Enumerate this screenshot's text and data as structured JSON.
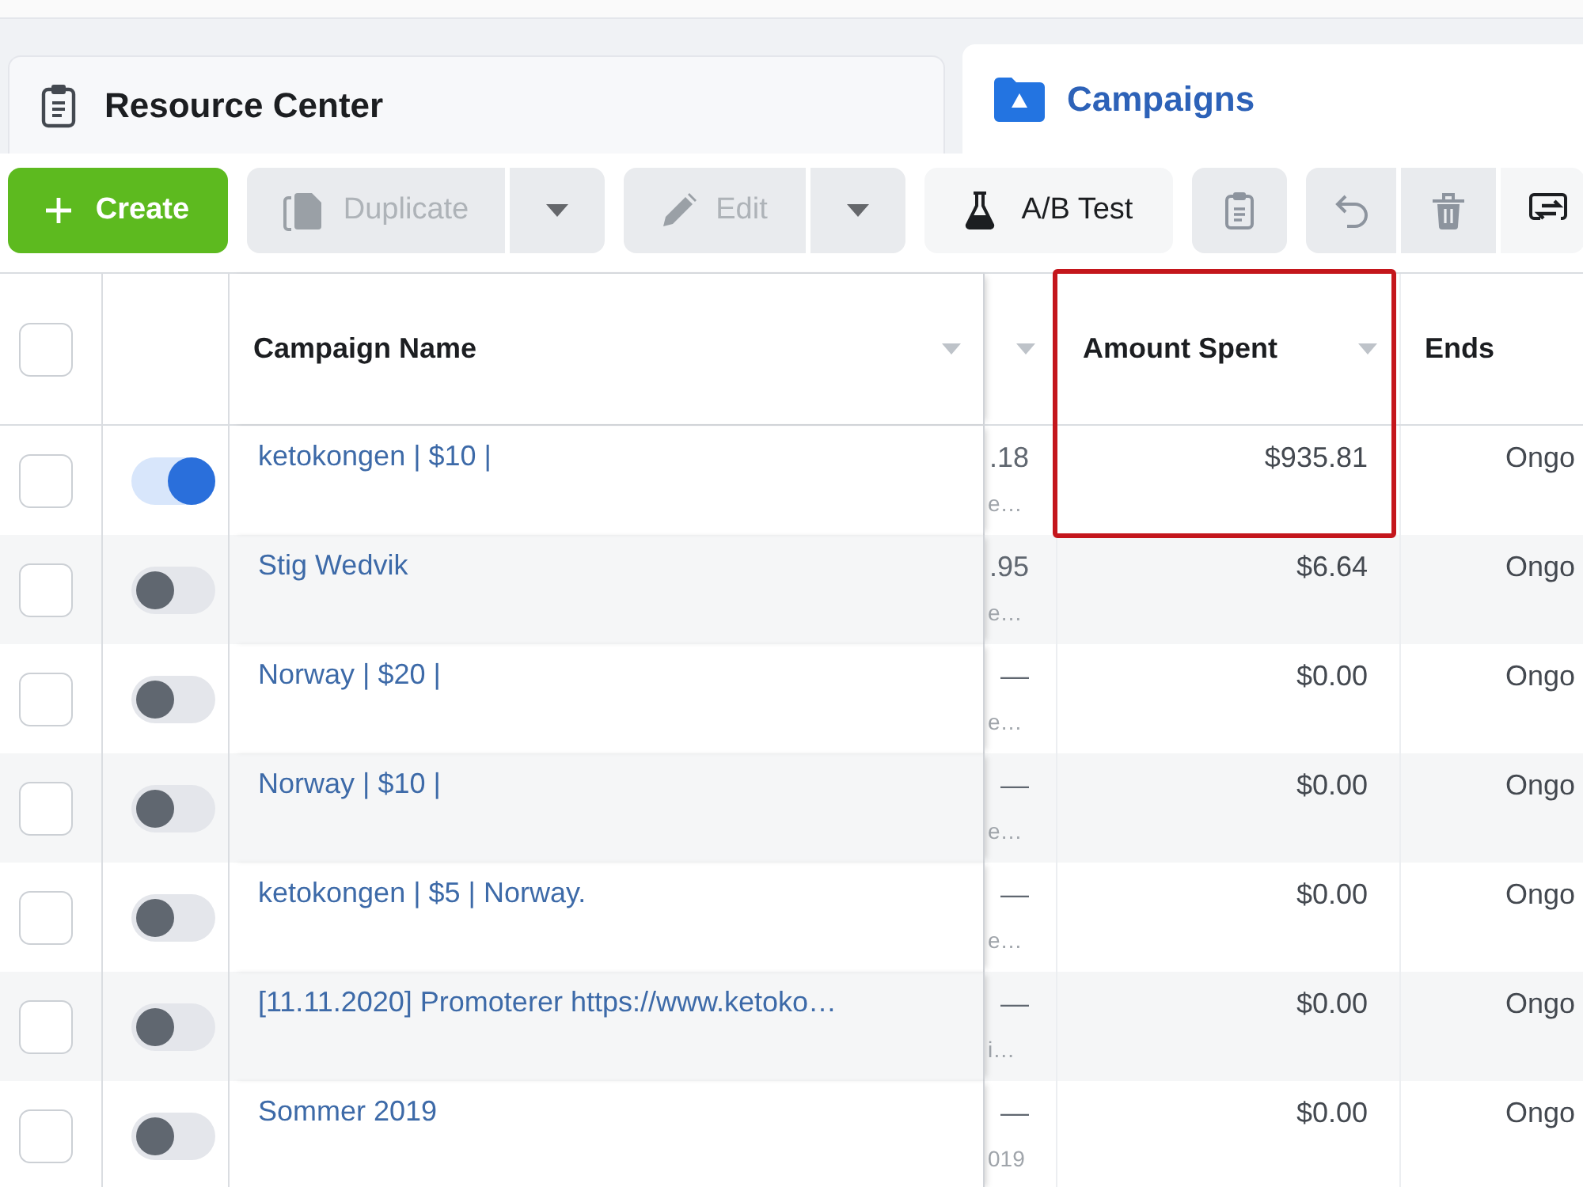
{
  "tabs": [
    {
      "label": "Resource Center",
      "kind": "resources",
      "selected": false
    },
    {
      "label": "Campaigns",
      "kind": "campaigns",
      "selected": true
    }
  ],
  "toolbar": [
    {
      "buttons": [
        {
          "kind": "create",
          "label": "Create",
          "disabled": false
        }
      ]
    },
    {
      "buttons": [
        {
          "kind": "duplicate",
          "label": "Duplicate",
          "disabled": true
        },
        {
          "kind": "menu",
          "disabled": true
        }
      ]
    },
    {
      "buttons": [
        {
          "kind": "edit",
          "label": "Edit",
          "disabled": true
        },
        {
          "kind": "menu",
          "disabled": true
        }
      ]
    },
    {
      "buttons": [
        {
          "kind": "ab-test",
          "label": "A/B Test",
          "disabled": false
        }
      ]
    },
    {
      "buttons": [
        {
          "kind": "clipboard",
          "disabled": true
        }
      ]
    },
    {
      "buttons": [
        {
          "kind": "undo",
          "disabled": true
        },
        {
          "kind": "delete",
          "disabled": true
        },
        {
          "kind": "export",
          "disabled": false
        }
      ]
    }
  ],
  "table": {
    "select_all_checked": false,
    "columns": [
      {
        "label": "Campaign Name",
        "sortable": true
      },
      {
        "sortable": true
      },
      {
        "label": "Amount Spent",
        "sortable": true,
        "highlighted": true
      },
      {
        "label": "Ends"
      }
    ],
    "rows": [
      {
        "checked": false,
        "on": true,
        "name": "ketokongen | $10 |",
        "column_2": ".18",
        "column_2_note": "e…",
        "amount_spent": "$935.81",
        "ends": "Ongo"
      },
      {
        "checked": false,
        "on": false,
        "name": "Stig Wedvik",
        "column_2": ".95",
        "column_2_note": "e…",
        "amount_spent": "$6.64",
        "ends": "Ongo"
      },
      {
        "checked": false,
        "on": false,
        "name": "Norway | $20 |",
        "column_2": "—",
        "column_2_note": "e…",
        "amount_spent": "$0.00",
        "ends": "Ongo"
      },
      {
        "checked": false,
        "on": false,
        "name": "Norway | $10 |",
        "column_2": "—",
        "column_2_note": "e…",
        "amount_spent": "$0.00",
        "ends": "Ongo"
      },
      {
        "checked": false,
        "on": false,
        "name": "ketokongen | $5 | Norway.",
        "column_2": "—",
        "column_2_note": "e…",
        "amount_spent": "$0.00",
        "ends": "Ongo"
      },
      {
        "checked": false,
        "on": false,
        "name": "[11.11.2020] Promoterer https://www.ketoko…",
        "column_2": "—",
        "column_2_note": "i…",
        "amount_spent": "$0.00",
        "ends": "Ongo"
      },
      {
        "checked": false,
        "on": false,
        "name": "Sommer 2019",
        "column_2": "—",
        "column_2_note": "019",
        "amount_spent": "$0.00",
        "ends": "Ongo"
      }
    ]
  }
}
